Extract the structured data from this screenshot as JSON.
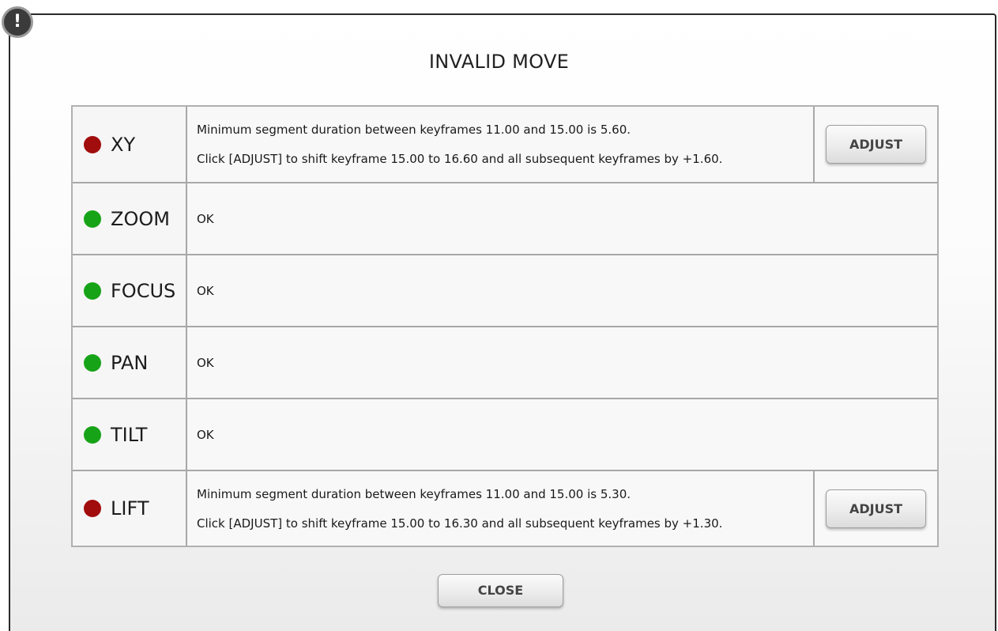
{
  "dialog": {
    "alert_icon_glyph": "!",
    "title": "INVALID MOVE",
    "close_label": "CLOSE"
  },
  "colors": {
    "error": "#a10c0c",
    "ok": "#17a317"
  },
  "axes": [
    {
      "name": "XY",
      "status": "error",
      "line1": "Minimum segment duration between keyframes 11.00 and 15.00 is 5.60.",
      "line2": "Click [ADJUST] to shift keyframe 15.00 to 16.60 and all subsequent keyframes by +1.60.",
      "action_label": "ADJUST"
    },
    {
      "name": "ZOOM",
      "status": "ok",
      "message": "OK"
    },
    {
      "name": "FOCUS",
      "status": "ok",
      "message": "OK"
    },
    {
      "name": "PAN",
      "status": "ok",
      "message": "OK"
    },
    {
      "name": "TILT",
      "status": "ok",
      "message": "OK"
    },
    {
      "name": "LIFT",
      "status": "error",
      "line1": "Minimum segment duration between keyframes 11.00 and 15.00 is 5.30.",
      "line2": "Click [ADJUST] to shift keyframe 15.00 to 16.30 and all subsequent keyframes by +1.30.",
      "action_label": "ADJUST"
    }
  ]
}
